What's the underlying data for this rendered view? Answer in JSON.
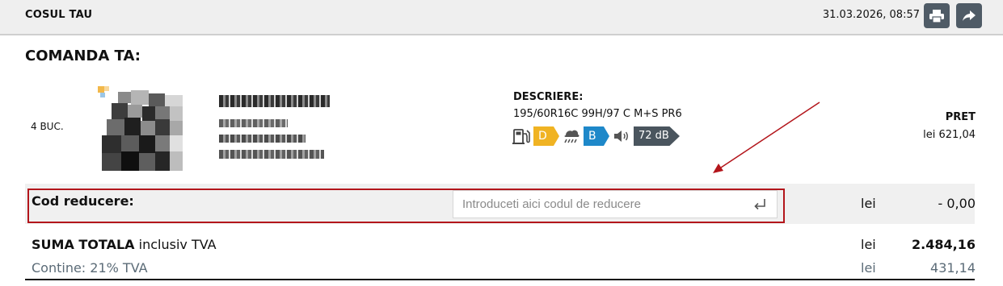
{
  "header": {
    "title": "COSUL TAU",
    "datetime": "31.03.2026, 08:57"
  },
  "order": {
    "title": "COMANDA TA:",
    "item": {
      "quantity": "4 BUC.",
      "description_label": "DESCRIERE:",
      "description": "195/60R16C 99H/97 C M+S PR6",
      "eu_label": {
        "fuel_class": "D",
        "wet_grip_class": "B",
        "noise": "72 dB",
        "colors": {
          "fuel": "#f0b323",
          "wet": "#1e88c9",
          "noise": "#4a555e"
        }
      },
      "price_label": "PRET",
      "price": "lei 621,04"
    }
  },
  "discount": {
    "label": "Cod reducere:",
    "placeholder": "Introduceti aici codul de reducere",
    "currency": "lei",
    "value": "- 0,00"
  },
  "totals": {
    "total_label_bold": "SUMA TOTALA",
    "total_label_rest": " inclusiv TVA",
    "total_currency": "lei",
    "total_value": "2.484,16",
    "vat_label": "Contine: 21% TVA",
    "vat_currency": "lei",
    "vat_value": "431,14"
  },
  "colors": {
    "header_bg": "#efefef",
    "button_bg": "#4f5b66",
    "highlight_border": "#b3151b",
    "arrow": "#b3151b"
  }
}
